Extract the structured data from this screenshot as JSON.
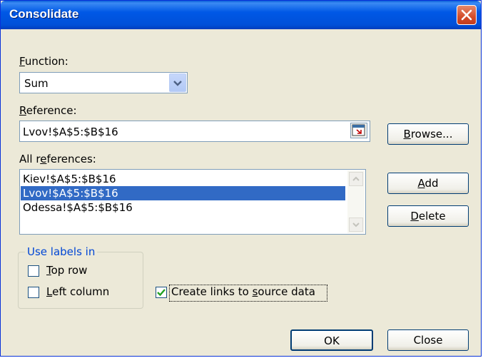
{
  "window": {
    "title": "Consolidate"
  },
  "function": {
    "label": "Function:",
    "value": "Sum"
  },
  "reference": {
    "label": "Reference:",
    "value": "Lvov!$A$5:$B$16"
  },
  "all_references": {
    "label": "All references:",
    "items": [
      "Kiev!$A$5:$B$16",
      "Lvov!$A$5:$B$16",
      "Odessa!$A$5:$B$16"
    ],
    "selected": "Lvov!$A$5:$B$16"
  },
  "buttons": {
    "browse": "Browse...",
    "add": "Add",
    "delete": "Delete",
    "ok": "OK",
    "close": "Close"
  },
  "use_labels": {
    "legend": "Use labels in",
    "top_row": {
      "label": "Top row",
      "checked": false
    },
    "left_column": {
      "label": "Left column",
      "checked": false
    }
  },
  "create_links": {
    "label": "Create links to source data",
    "checked": true
  },
  "colors": {
    "title_bar": "#0058e6",
    "dialog_bg": "#ece9d8",
    "selection": "#316ac5",
    "close_button": "#d44d2a",
    "group_legend": "#0046d5"
  },
  "icons": {
    "close": "close-icon",
    "dropdown": "chevron-down-icon",
    "collapse_dialog": "collapse-dialog-icon",
    "scroll_up": "scroll-up-icon",
    "scroll_down": "scroll-down-icon",
    "checkmark": "checkmark-icon"
  }
}
